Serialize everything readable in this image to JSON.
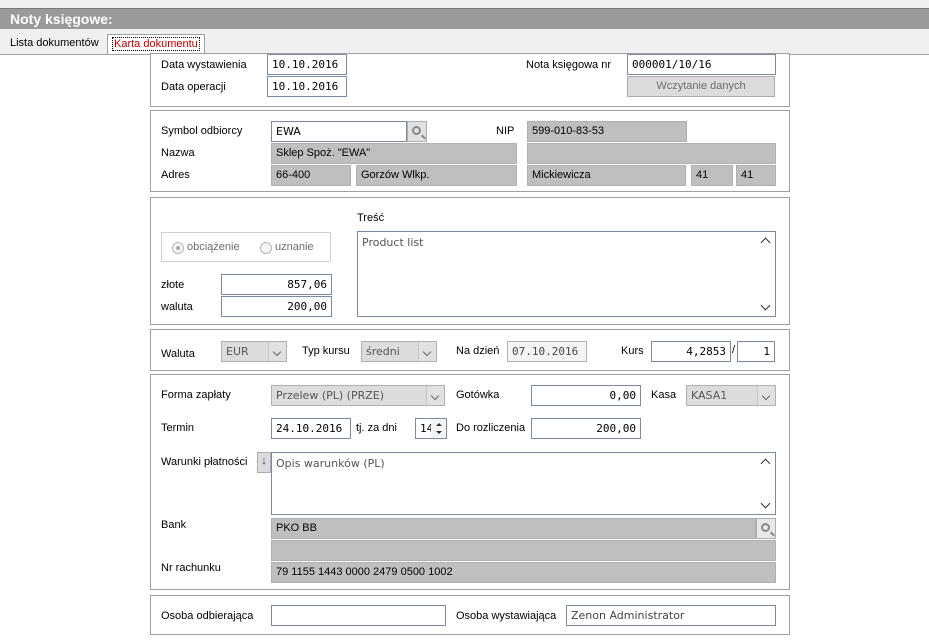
{
  "window": {
    "title": "Noty księgowe:"
  },
  "tabs": [
    {
      "label": "Lista dokumentów"
    },
    {
      "label": "Karta dokumentu"
    }
  ],
  "header": {
    "issue_date_label": "Data wystawienia",
    "issue_date": "10.10.2016",
    "operation_date_label": "Data operacji",
    "operation_date": "10.10.2016",
    "note_no_label": "Nota księgowa nr",
    "note_no": "000001/10/16",
    "load_data_button": "Wczytanie danych"
  },
  "recipient": {
    "symbol_label": "Symbol odbiorcy",
    "symbol": "EWA",
    "nip_label": "NIP",
    "nip": "599-010-83-53",
    "name_label": "Nazwa",
    "name": "Sklep Spoż. \"EWA\"",
    "name2": "",
    "address_label": "Adres",
    "postal_code": "66-400",
    "city": "Gorzów Wlkp.",
    "street": "Mickiewicza",
    "house_no": "41",
    "flat_no": "41"
  },
  "type": {
    "debit_label": "obciążenie",
    "credit_label": "uznanie",
    "selected": "obciążenie",
    "pln_label": "złote",
    "pln_amount": "857,06",
    "currency_label": "waluta",
    "currency_amount": "200,00",
    "content_label": "Treść",
    "content": "Product list"
  },
  "currency": {
    "currency_label": "Waluta",
    "currency": "EUR",
    "rate_type_label": "Typ kursu",
    "rate_type": "średni",
    "date_label": "Na dzień",
    "date": "07.10.2016",
    "rate_label": "Kurs",
    "rate": "4,2853",
    "rate_separator": "/",
    "rate_unit": "1"
  },
  "payment": {
    "form_label": "Forma zapłaty",
    "form": "Przelew (PL)  (PRZE)",
    "cash_label": "Gotówka",
    "cash": "0,00",
    "cashbox_label": "Kasa",
    "cashbox": "KASA1",
    "due_label": "Termin",
    "due_date": "24.10.2016",
    "days_label": "tj. za dni",
    "days": "14",
    "to_settle_label": "Do rozliczenia",
    "to_settle": "200,00",
    "terms_label": "Warunki płatności",
    "terms_button": "↓",
    "terms": "Opis warunków (PL)",
    "bank_label": "Bank",
    "bank": "PKO BB",
    "bank2": "",
    "account_label": "Nr rachunku",
    "account": "79 1155 1443 0000 2479 0500 1002"
  },
  "persons": {
    "receiver_label": "Osoba odbierająca",
    "receiver": "",
    "issuer_label": "Osoba wystawiająca",
    "issuer": "Zenon Administrator"
  }
}
